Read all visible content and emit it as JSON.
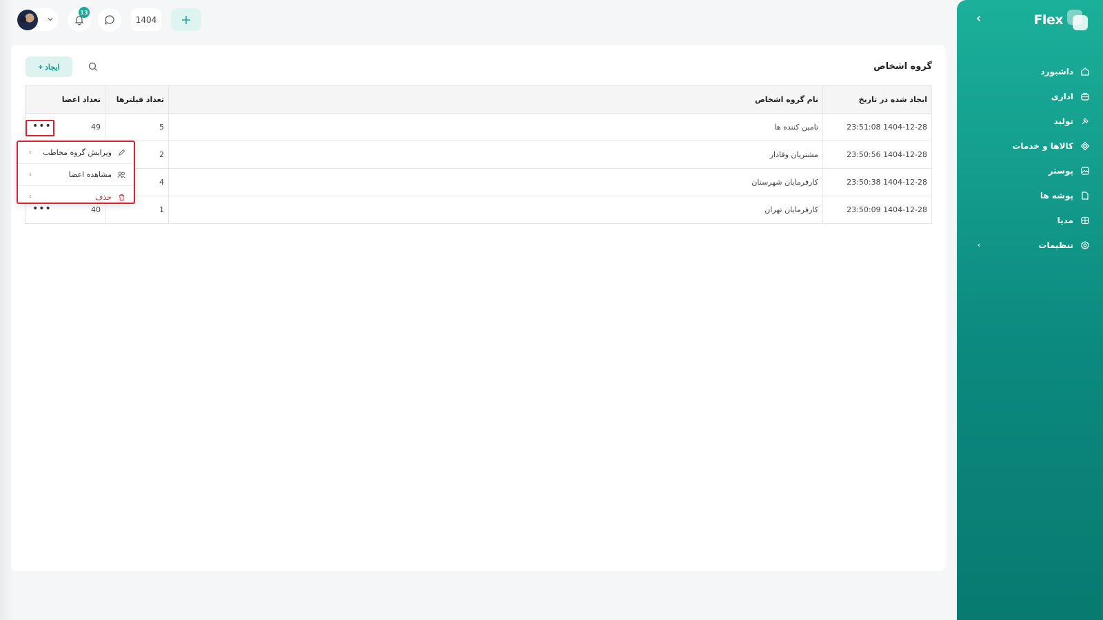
{
  "header": {
    "year": "1404",
    "notification_count": "13"
  },
  "sidebar": {
    "brand": "Flex",
    "items": [
      {
        "label": "داشبورد",
        "icon": "home-icon"
      },
      {
        "label": "اداری",
        "icon": "office-icon"
      },
      {
        "label": "تولید",
        "icon": "production-icon"
      },
      {
        "label": "کالاها و خدمات",
        "icon": "products-icon"
      },
      {
        "label": "پوستر",
        "icon": "poster-icon"
      },
      {
        "label": "پوشه ها",
        "icon": "folder-icon"
      },
      {
        "label": "مدیا",
        "icon": "media-icon"
      },
      {
        "label": "تنظیمات",
        "icon": "settings-icon"
      }
    ]
  },
  "main": {
    "title": "گروه اشخاص",
    "create_label": "+ ایجاد",
    "table": {
      "columns": [
        "ایجاد شده در تاریخ",
        "نام گروه اشخاص",
        "تعداد فیلترها",
        "تعداد اعضا"
      ],
      "rows": [
        {
          "date": "1404-12-28 23:51:08",
          "name": "تامین کننده ها",
          "filters": "5",
          "members": "49"
        },
        {
          "date": "1404-12-28 23:50:56",
          "name": "مشتریان وفادار",
          "filters": "2",
          "members": ""
        },
        {
          "date": "1404-12-28 23:50:38",
          "name": "کارفرمایان شهرستان",
          "filters": "4",
          "members": ""
        },
        {
          "date": "1404-12-28 23:50:09",
          "name": "کارفرمایان تهران",
          "filters": "1",
          "members": "40"
        }
      ]
    },
    "row_menu": {
      "items": [
        {
          "label": "ویرایش گروه مخاطب",
          "icon": "edit-icon"
        },
        {
          "label": "مشاهده اعضا",
          "icon": "members-icon"
        },
        {
          "label": "حذف",
          "icon": "trash-icon"
        }
      ]
    },
    "colors": {
      "accent": "#17a99a",
      "danger": "#d92b2b",
      "highlight": "#e0202a"
    }
  }
}
